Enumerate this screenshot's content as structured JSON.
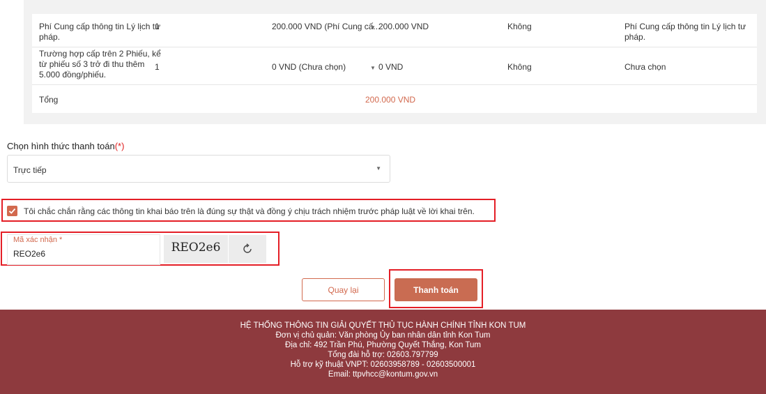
{
  "fee_table": {
    "rows": [
      {
        "name": "Phí Cung cấp thông tin Lý lịch tư pháp.",
        "quantity": "1",
        "price": "200.000 VND (Phí Cung cấ...",
        "amount": "200.000 VND",
        "free": "Không",
        "note": "Phí Cung cấp thông tin Lý lịch tư pháp."
      },
      {
        "name": "Trường hợp cấp trên 2 Phiếu, kể từ phiếu số 3 trở đi thu thêm 5.000 đồng/phiếu.",
        "quantity": "1",
        "price": "0 VND (Chưa chọn)",
        "amount": "0 VND",
        "free": "Không",
        "note": "Chưa chọn"
      }
    ],
    "total_label": "Tổng",
    "total_amount": "200.000 VND"
  },
  "payment": {
    "label": "Chọn hình thức thanh toán",
    "required_mark": "(*)",
    "selected": "Trực tiếp"
  },
  "confirm": {
    "checked": true,
    "text": "Tôi chắc chắn rằng các thông tin khai báo trên là đúng sự thật và đồng ý chịu trách nhiệm trước pháp luật về lời khai trên."
  },
  "captcha": {
    "label": "Mã xác nhận *",
    "value": "REO2e6",
    "code": "REO2e6",
    "refresh_icon": "refresh-icon"
  },
  "actions": {
    "back_label": "Quay lại",
    "pay_label": "Thanh toán"
  },
  "footer": {
    "title": "HỆ THỐNG THÔNG TIN GIẢI QUYẾT THỦ TỤC HÀNH CHÍNH TỈNH KON TUM",
    "owner": "Đơn vị chủ quản: Văn phòng Ủy ban nhân dân tỉnh Kon Tum",
    "address": "Địa chỉ: 492 Trần Phú, Phường Quyết Thắng, Kon Tum",
    "hotline": "Tổng đài hỗ trợ: 02603.797799",
    "tech_support": "Hỗ trợ kỹ thuật VNPT: 02603958789 - 02603500001",
    "email": "Email: ttpvhcc@kontum.gov.vn"
  },
  "colors": {
    "accent": "#d2694e",
    "pay_button": "#c96c52",
    "footer_bg": "#8e3a3e",
    "highlight_border": "#e41e26"
  }
}
